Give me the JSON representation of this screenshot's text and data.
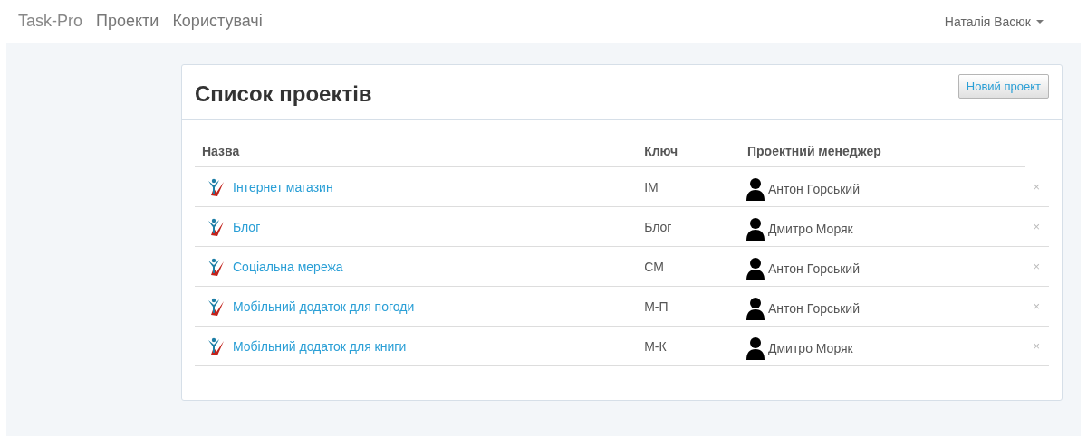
{
  "navbar": {
    "brand": "Task-Pro",
    "links": [
      {
        "label": "Проекти"
      },
      {
        "label": "Користувачі"
      }
    ],
    "user": "Наталія Васюк"
  },
  "panel": {
    "title": "Список проектів",
    "new_button": "Новий проект",
    "columns": [
      "Назва",
      "Ключ",
      "Проектний менеджер"
    ],
    "rows": [
      {
        "name": "Інтернет магазин",
        "key": "IM",
        "manager": "Антон Горський",
        "delete": "×"
      },
      {
        "name": "Блог",
        "key": "Блог",
        "manager": "Дмитро Моряк",
        "delete": "×"
      },
      {
        "name": "Соціальна мережа",
        "key": "CM",
        "manager": "Антон Горський",
        "delete": "×"
      },
      {
        "name": "Мобільний додаток для погоди",
        "key": "М-П",
        "manager": "Антон Горський",
        "delete": "×"
      },
      {
        "name": "Мобільний додаток для книги",
        "key": "М-К",
        "manager": "Дмитро Моряк",
        "delete": "×"
      }
    ]
  }
}
